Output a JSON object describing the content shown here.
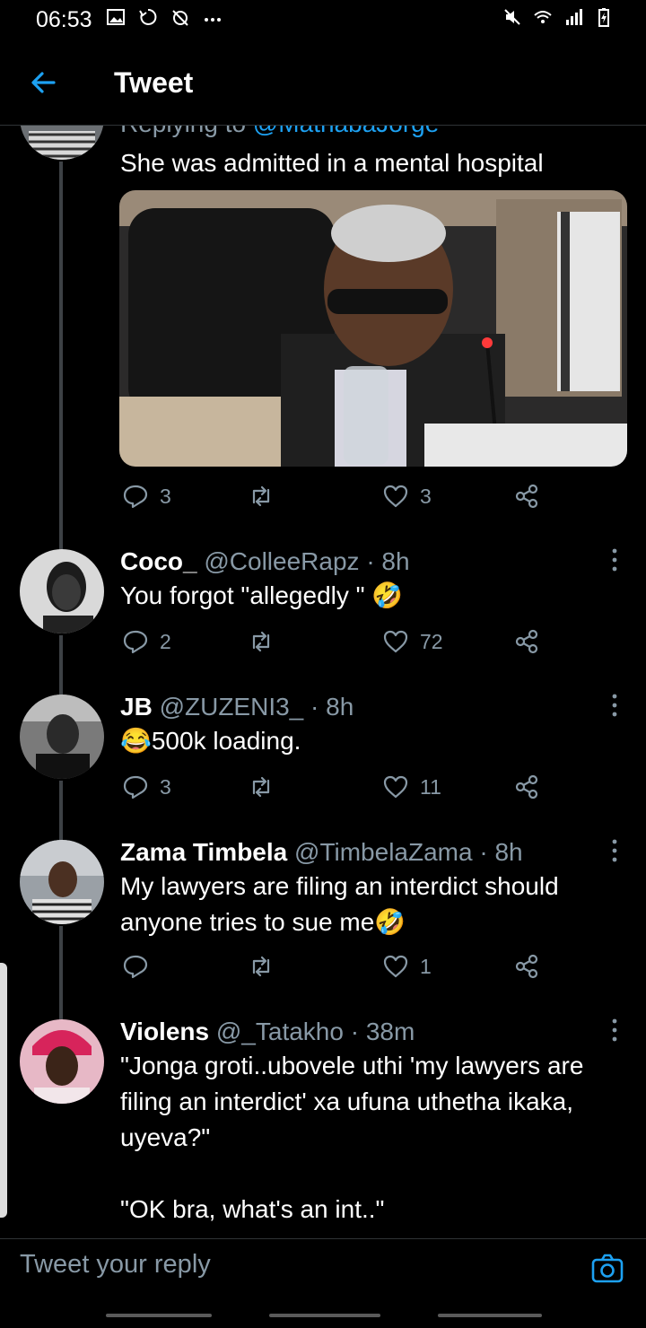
{
  "status_bar": {
    "time": "06:53",
    "left_icons": [
      "gallery-icon",
      "sync-icon",
      "wifi-off-icon",
      "more-dots-icon"
    ],
    "right_icons": [
      "mute-icon",
      "wifi-icon",
      "signal-icon",
      "battery-icon"
    ]
  },
  "header": {
    "back_icon": "back-arrow-icon",
    "title": "Tweet"
  },
  "colors": {
    "accent": "#1da1f2",
    "muted": "#8899a6",
    "background": "#000000",
    "divider": "#2f3336"
  },
  "parent_tweet": {
    "replying_to_prefix": "Replying to",
    "replying_to_handle": "@MathabaJorge",
    "text": "She was admitted in a mental hospital",
    "replies": "3",
    "retweets": "",
    "likes": "3"
  },
  "replies": [
    {
      "name": "Coco_",
      "handle": "@ColleeRapz",
      "time": "· 8h",
      "text": "You forgot \"allegedly \" 🤣",
      "replies": "2",
      "retweets": "",
      "likes": "72"
    },
    {
      "name": "JB",
      "handle": "@ZUZENI3_",
      "time": "· 8h",
      "text": "😂500k loading.",
      "replies": "3",
      "retweets": "",
      "likes": "11"
    },
    {
      "name": "Zama Timbela",
      "handle": "@TimbelaZama",
      "time": "· 8h",
      "text": "My lawyers are filing an interdict should anyone tries to sue me🤣",
      "replies": "",
      "retweets": "",
      "likes": "1"
    },
    {
      "name": "Violens",
      "handle": "@_Tatakho",
      "time": "· 38m",
      "text_line1": "\"Jonga groti..ubovele uthi 'my lawyers are filing an interdict' xa ufuna uthetha ikaka, uyeva?\"",
      "text_line2": "\"OK bra, what's an int..\""
    }
  ],
  "reply_bar": {
    "placeholder": "Tweet your reply",
    "camera_icon": "camera-icon"
  }
}
